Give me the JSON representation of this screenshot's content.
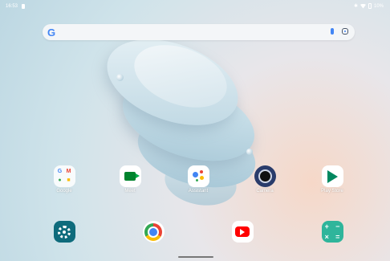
{
  "status_bar": {
    "time": "16:53",
    "battery": "10%"
  },
  "search_bar": {
    "logo": "G",
    "icons": [
      "mic-icon",
      "lens-icon"
    ]
  },
  "apps_row": [
    {
      "label": "Google",
      "icon": "google-folder-icon"
    },
    {
      "label": "Meet",
      "icon": "meet-icon"
    },
    {
      "label": "Assistant",
      "icon": "assistant-icon"
    },
    {
      "label": "Camera",
      "icon": "camera-icon"
    },
    {
      "label": "Play Store",
      "icon": "play-store-icon"
    }
  ],
  "dock": [
    {
      "icon": "settings-icon"
    },
    {
      "icon": "chrome-icon"
    },
    {
      "icon": "youtube-icon"
    },
    {
      "icon": "calculator-icon"
    }
  ],
  "colors": {
    "settings": "#0e6b7c",
    "youtube": "#ff0000",
    "play": "#01875f",
    "calculator": "#2fb59b"
  }
}
